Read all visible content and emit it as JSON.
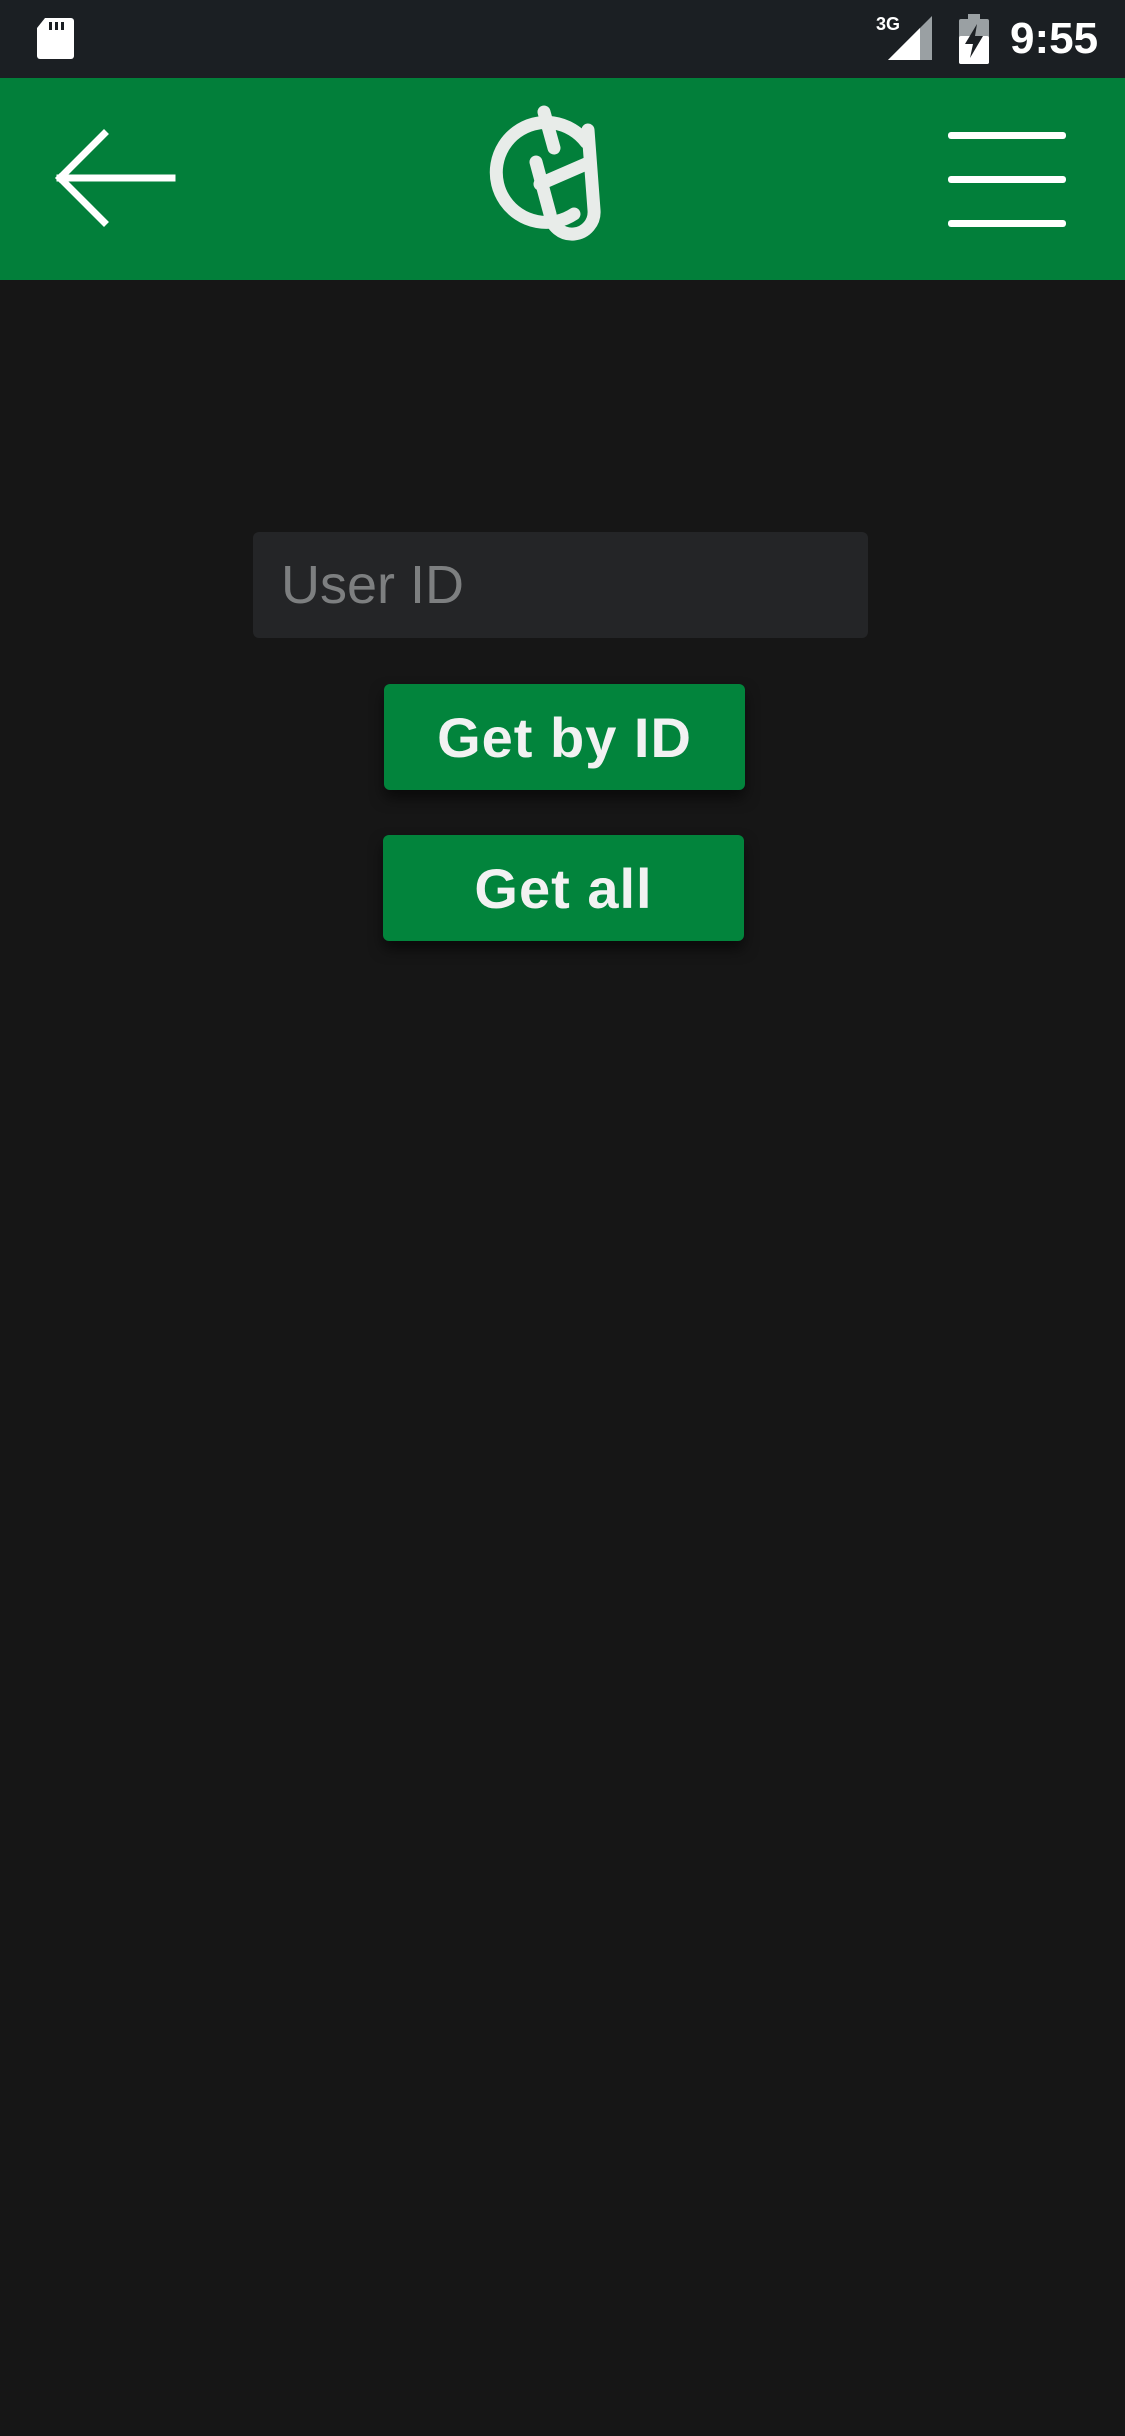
{
  "status_bar": {
    "network_type": "3G",
    "time": "9:55",
    "icons": [
      "sd-card-icon",
      "signal-icon",
      "battery-charging-icon"
    ]
  },
  "app_bar": {
    "background_color": "#027f3a",
    "back_icon": "arrow-left-icon",
    "logo_icon": "app-logo-icon",
    "menu_icon": "hamburger-menu-icon"
  },
  "form": {
    "user_id_placeholder": "User ID",
    "user_id_value": "",
    "get_by_id_label": "Get by ID",
    "get_all_label": "Get all"
  },
  "colors": {
    "background": "#161616",
    "accent": "#02843c",
    "input_background": "#242527"
  }
}
